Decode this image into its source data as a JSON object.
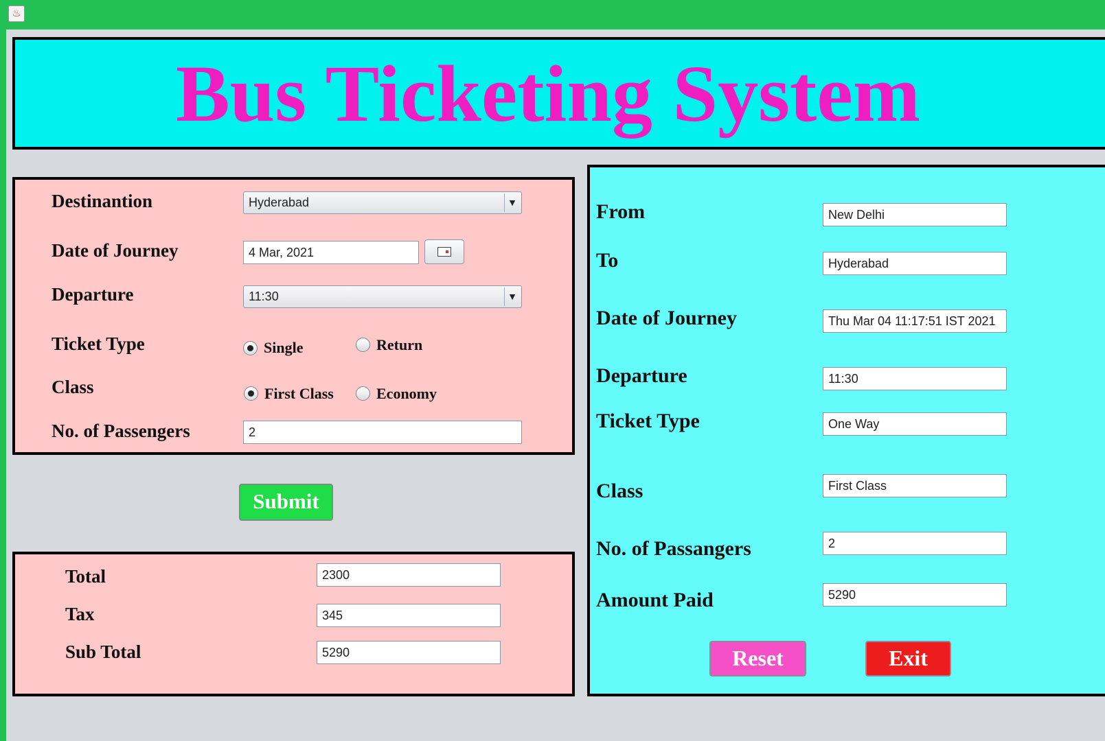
{
  "window": {
    "icon": "java-cup-icon",
    "icon_glyph": "♨"
  },
  "header": {
    "title": "Bus Ticketing System"
  },
  "form": {
    "destination_label": "Destinantion",
    "destination_value": "Hyderabad",
    "date_label": "Date of Journey",
    "date_value": "4 Mar, 2021",
    "departure_label": "Departure",
    "departure_value": "11:30",
    "ticket_type_label": "Ticket Type",
    "ticket_single": "Single",
    "ticket_return": "Return",
    "class_label": "Class",
    "class_first": "First Class",
    "class_economy": "Economy",
    "passengers_label": "No. of Passengers",
    "passengers_value": "2",
    "dropdown_arrow": "▼"
  },
  "actions": {
    "submit": "Submit",
    "reset": "Reset",
    "exit": "Exit"
  },
  "totals": {
    "total_label": "Total",
    "total_value": "2300",
    "tax_label": "Tax",
    "tax_value": "345",
    "subtotal_label": "Sub Total",
    "subtotal_value": "5290"
  },
  "summary": {
    "from_label": "From",
    "from_value": "New Delhi",
    "to_label": "To",
    "to_value": "Hyderabad",
    "date_label": "Date of Journey",
    "date_value": "Thu Mar 04 11:17:51 IST 2021",
    "departure_label": "Departure",
    "departure_value": "11:30",
    "ticket_type_label": "Ticket Type",
    "ticket_type_value": "One Way",
    "class_label": "Class",
    "class_value": "First Class",
    "passengers_label": "No. of Passangers",
    "passengers_value": "2",
    "amount_label": "Amount Paid",
    "amount_value": "5290"
  },
  "colors": {
    "titlebar": "#22c055",
    "banner_bg": "#00f2ef",
    "banner_text": "#ef1ec1",
    "pink_panel": "#ffc9c9",
    "cyan_panel": "#63fcfb",
    "submit": "#1fdd47",
    "reset": "#f550c8",
    "exit": "#ee1d1d"
  }
}
